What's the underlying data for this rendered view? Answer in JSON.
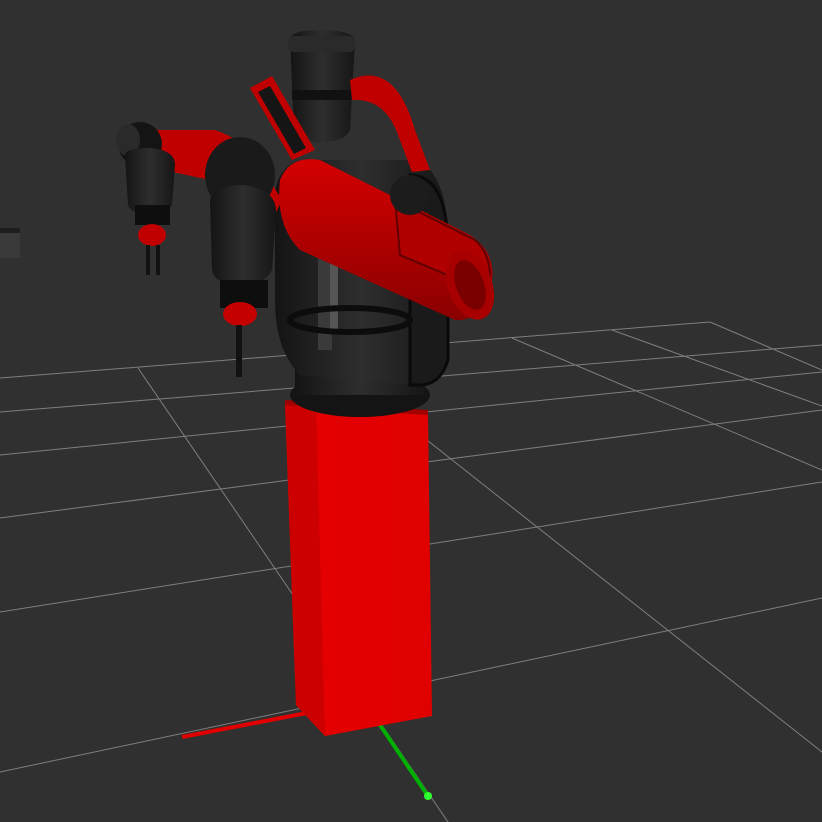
{
  "viewport": {
    "background_color": "#303030",
    "grid": {
      "visible": true,
      "line_color": "#a0a0a0"
    }
  },
  "robot": {
    "body_color": "#c00000",
    "dark_color": "#1c1c1c",
    "pedestal_color": "#e00000"
  },
  "axes": {
    "x_color": "#e00000",
    "y_color": "#00c000"
  },
  "icons": [
    "robot-model",
    "grid-floor",
    "axis-marker"
  ]
}
